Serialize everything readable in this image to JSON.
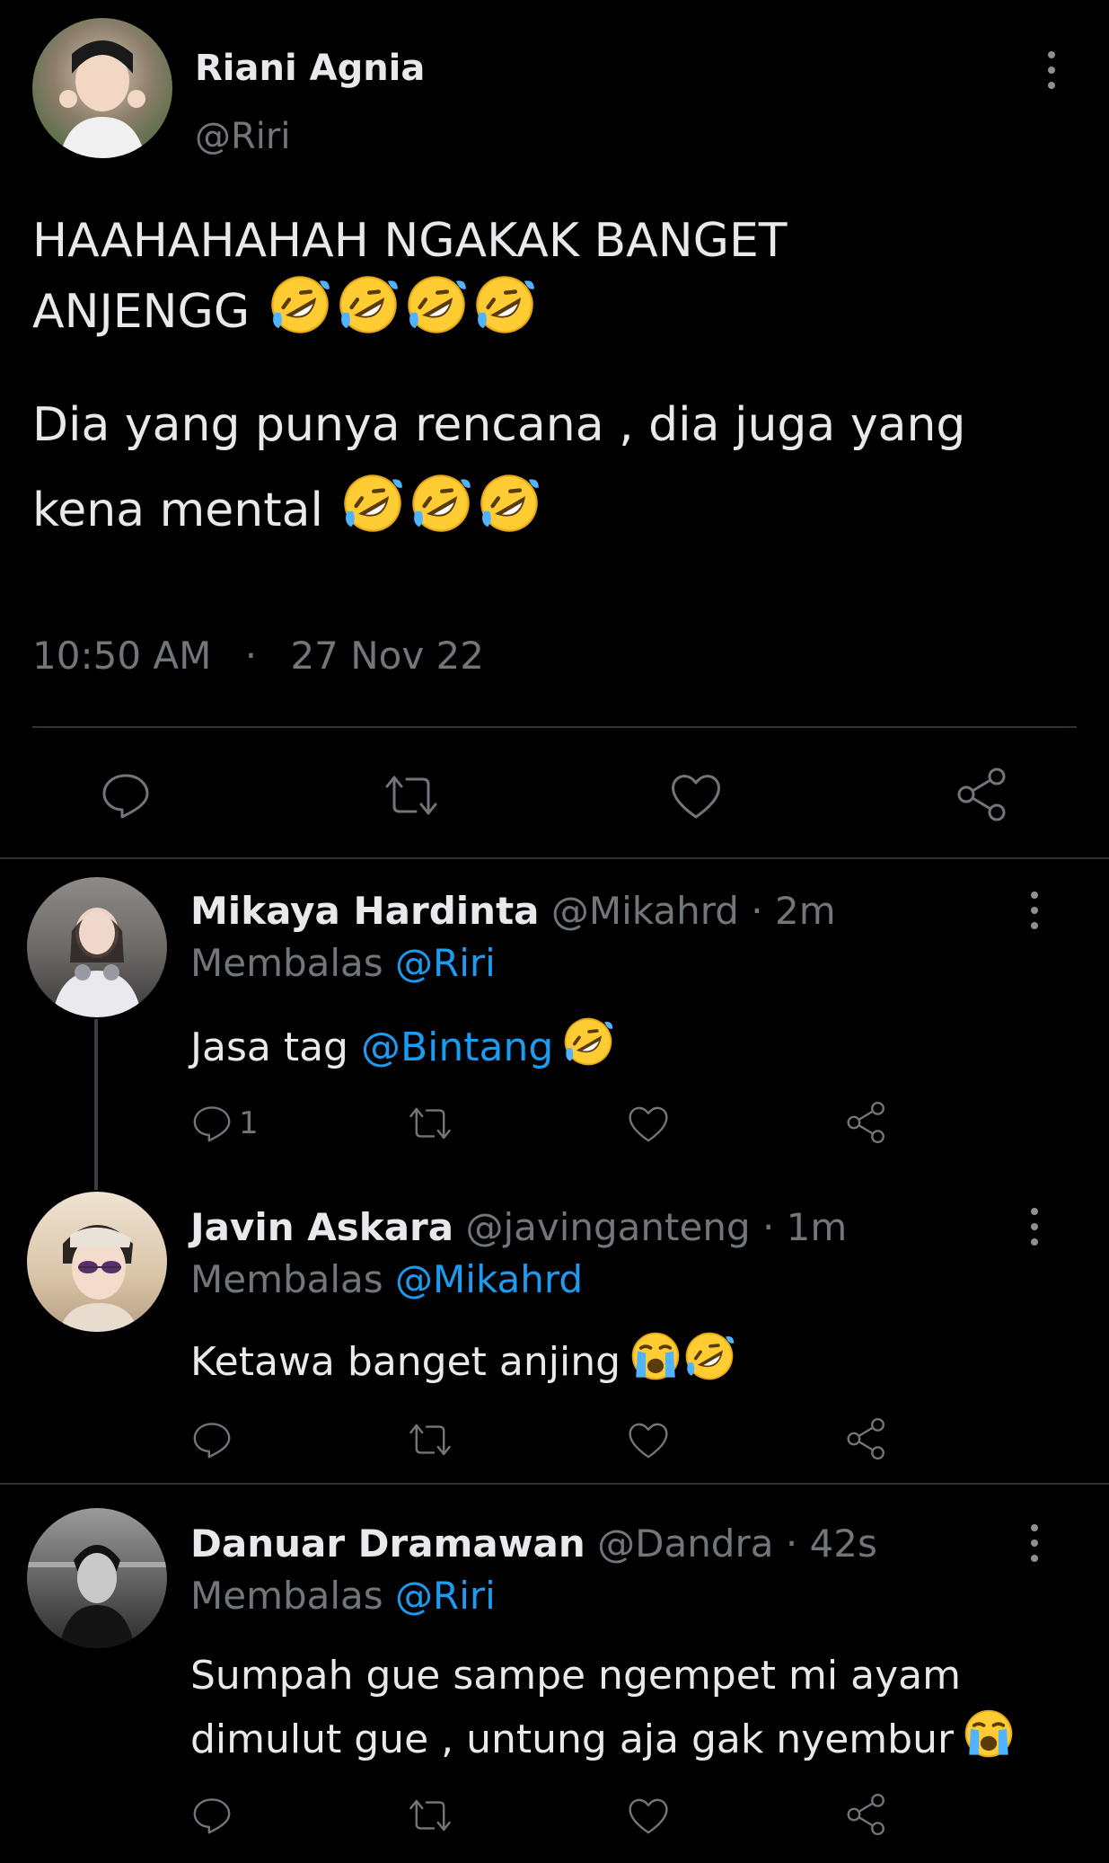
{
  "main_tweet": {
    "name": "Riani Agnia",
    "handle": "@Riri",
    "text_line1": "HAAHAHAHAH NGAKAK BANGET",
    "text_line2": "ANJENGG",
    "text_line3": "Dia yang punya rencana , dia juga yang",
    "text_line4": "kena mental",
    "time": "10:50 AM",
    "dot": "·",
    "date": "27 Nov 22"
  },
  "replies": [
    {
      "name": "Mikaya Hardinta",
      "handle": "@Mikahrd",
      "age": "· 2m",
      "replying_prefix": "Membalas",
      "replying_to": "@Riri",
      "text_before": "Jasa tag",
      "mention": "@Bintang",
      "reply_count": "1"
    },
    {
      "name": "Javin Askara",
      "handle": "@javinganteng",
      "age": "· 1m",
      "replying_prefix": "Membalas",
      "replying_to": "@Mikahrd",
      "text": "Ketawa banget anjing"
    },
    {
      "name": "Danuar Dramawan",
      "handle": "@Dandra",
      "age": "· 42s",
      "replying_prefix": "Membalas",
      "replying_to": "@Riri",
      "text_line1": "Sumpah gue sampe ngempet mi ayam",
      "text_line2": "dimulut gue , untung aja gak nyembur"
    }
  ],
  "colors": {
    "background": "#000000",
    "text": "#e7e9ea",
    "secondary": "#71767b",
    "accent": "#1d9bf0",
    "divider": "#2f3336"
  },
  "icons": [
    "reply-icon",
    "retweet-icon",
    "like-icon",
    "share-icon",
    "more-icon",
    "rofl-emoji",
    "crying-emoji"
  ]
}
